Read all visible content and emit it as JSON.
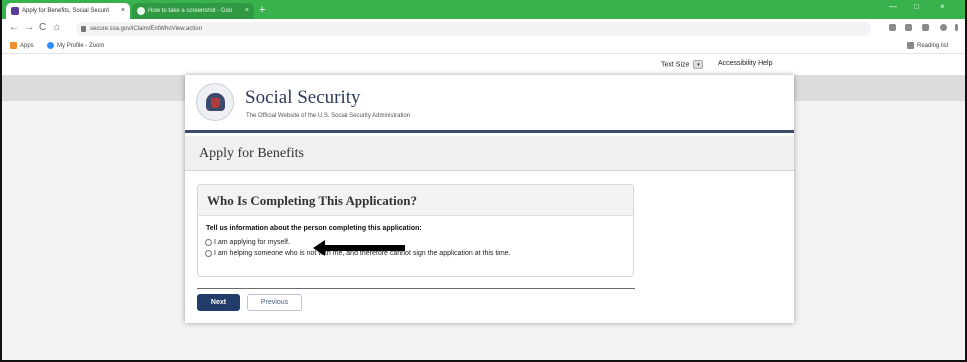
{
  "browser": {
    "tabs": [
      {
        "label": "Apply for Benefits, Social Securit",
        "close": "×"
      },
      {
        "label": "How to take a screenshot - Goo",
        "close": "×"
      }
    ],
    "new_tab": "+",
    "window_controls": [
      "—",
      "□",
      "×"
    ],
    "url": "secure.ssa.gov/iClaim/EntWhoView.action",
    "nav": {
      "back": "←",
      "forward": "→",
      "reload": "C",
      "home": "⌂"
    },
    "bookmarks": [
      {
        "label": "Apps"
      },
      {
        "label": "My Profile - Zoom"
      }
    ],
    "reading_list": "Reading list"
  },
  "utility": {
    "text_size": "Text Size",
    "text_size_caret": "▾",
    "accessibility": "Accessibility Help"
  },
  "header": {
    "org_name": "Social Security",
    "tagline": "The Official Website of the U.S. Social Security Administration"
  },
  "page": {
    "title": "Apply for Benefits"
  },
  "panel": {
    "title": "Who Is Completing This Application?",
    "prompt": "Tell us information about the person completing this application:",
    "options": [
      {
        "label": "I am applying for myself."
      },
      {
        "label": "I am helping someone who is not with me, and therefore cannot sign the application at this time."
      }
    ]
  },
  "actions": {
    "next": "Next",
    "previous": "Previous"
  },
  "colors": {
    "tab_strip": "#37b24d",
    "ssa_navy": "#2e3a5c",
    "next_button": "#233d6b"
  }
}
